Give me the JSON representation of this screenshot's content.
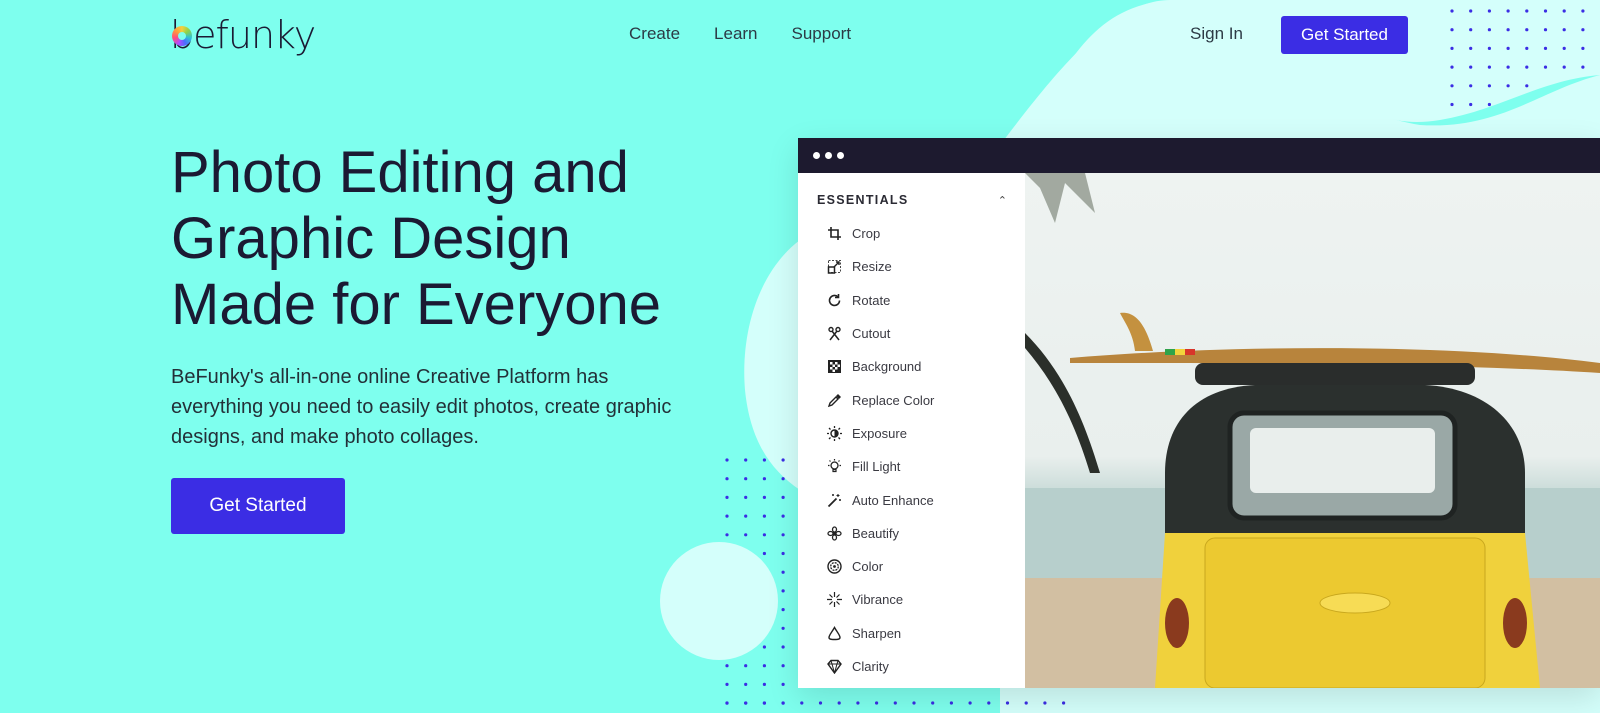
{
  "header": {
    "logo_text": "befunky",
    "nav": [
      {
        "label": "Create"
      },
      {
        "label": "Learn"
      },
      {
        "label": "Support"
      }
    ],
    "signin_label": "Sign In",
    "cta_label": "Get Started"
  },
  "hero": {
    "title_lines": [
      "Photo Editing and",
      "Graphic Design",
      "Made for Everyone"
    ],
    "description": "BeFunky's all-in-one online Creative Platform has everything you need to easily edit photos, create graphic designs, and make photo collages.",
    "cta_label": "Get Started"
  },
  "app": {
    "panel_title": "ESSENTIALS",
    "tools": [
      {
        "label": "Crop",
        "icon": "crop-icon"
      },
      {
        "label": "Resize",
        "icon": "resize-icon"
      },
      {
        "label": "Rotate",
        "icon": "rotate-icon"
      },
      {
        "label": "Cutout",
        "icon": "scissors-icon"
      },
      {
        "label": "Background",
        "icon": "checkerboard-icon"
      },
      {
        "label": "Replace Color",
        "icon": "eyedropper-icon"
      },
      {
        "label": "Exposure",
        "icon": "exposure-icon"
      },
      {
        "label": "Fill Light",
        "icon": "lightbulb-icon"
      },
      {
        "label": "Auto Enhance",
        "icon": "magic-wand-icon"
      },
      {
        "label": "Beautify",
        "icon": "flower-icon"
      },
      {
        "label": "Color",
        "icon": "color-wheel-icon"
      },
      {
        "label": "Vibrance",
        "icon": "sparkle-icon"
      },
      {
        "label": "Sharpen",
        "icon": "triangle-drop-icon"
      },
      {
        "label": "Clarity",
        "icon": "diamond-icon"
      }
    ]
  },
  "colors": {
    "background": "#7effee",
    "blob": "#d4fffb",
    "accent": "#3b2de4",
    "dots": "#3b2de4",
    "app_bar": "#1d1a2f"
  }
}
